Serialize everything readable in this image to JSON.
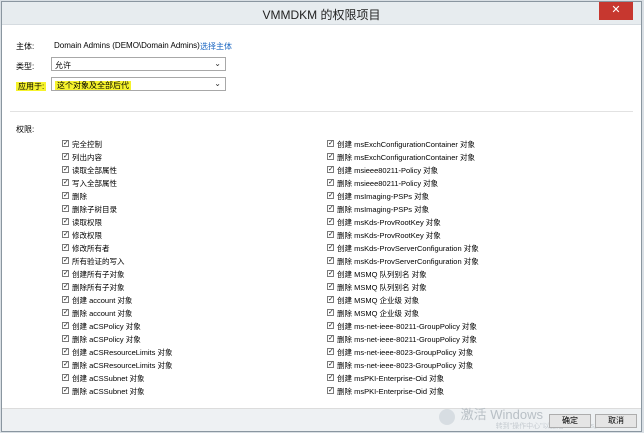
{
  "window": {
    "title": "VMMDKM 的权限项目",
    "close_glyph": "✕"
  },
  "principal": {
    "label": "主体:",
    "value": "Domain Admins (DEMO\\Domain Admins)",
    "link": "选择主体"
  },
  "type": {
    "label": "类型:",
    "value": "允许"
  },
  "applies_to": {
    "label": "应用于:",
    "value": "这个对象及全部后代"
  },
  "permissions": {
    "label": "权限:",
    "left": [
      "完全控制",
      "列出内容",
      "读取全部属性",
      "写入全部属性",
      "删除",
      "删除子树目录",
      "读取权限",
      "修改权限",
      "修改所有者",
      "所有验证的写入",
      "创建所有子对象",
      "删除所有子对象",
      "创建 account 对象",
      "删除 account 对象",
      "创建 aCSPolicy 对象",
      "删除 aCSPolicy 对象",
      "创建 aCSResourceLimits 对象",
      "删除 aCSResourceLimits 对象",
      "创建 aCSSubnet 对象",
      "删除 aCSSubnet 对象"
    ],
    "right": [
      "创建 msExchConfigurationContainer 对象",
      "删除 msExchConfigurationContainer 对象",
      "创建 msieee80211-Policy 对象",
      "删除 msieee80211-Policy 对象",
      "创建 msImaging-PSPs 对象",
      "删除 msImaging-PSPs 对象",
      "创建 msKds-ProvRootKey 对象",
      "删除 msKds-ProvRootKey 对象",
      "创建 msKds-ProvServerConfiguration 对象",
      "删除 msKds-ProvServerConfiguration 对象",
      "创建 MSMQ 队列别名 对象",
      "删除 MSMQ 队列别名 对象",
      "创建 MSMQ 企业级 对象",
      "删除 MSMQ 企业级 对象",
      "创建 ms-net-ieee-80211-GroupPolicy 对象",
      "删除 ms-net-ieee-80211-GroupPolicy 对象",
      "创建 ms-net-ieee-8023-GroupPolicy 对象",
      "删除 ms-net-ieee-8023-GroupPolicy 对象",
      "创建 msPKI-Enterprise-Oid 对象",
      "删除 msPKI-Enterprise-Oid 对象"
    ],
    "checked": true
  },
  "buttons": {
    "ok": "确定",
    "cancel": "取消"
  },
  "watermark": {
    "title": "激活 Windows",
    "sub": "转到\"操作中心\"以激活 Windows。"
  },
  "colors": {
    "highlight": "#f6f32c",
    "link": "#1a66c2",
    "close": "#c7372f"
  }
}
